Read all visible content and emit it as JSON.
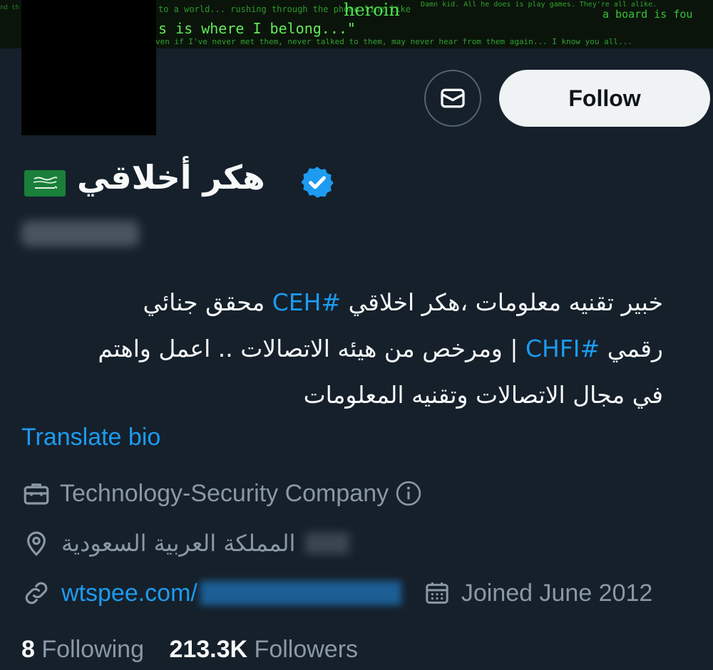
{
  "banner": {
    "line0": "nd th",
    "line1": "to a world... rushing through the phone line like",
    "word_heroin": "heroin",
    "line1b": "Damn kid. All he does is play games. They're all alike.",
    "line_board": "a board is fou",
    "line2": "s is where I belong...\"",
    "line3": "ven if I've never met them, never talked to them, may never hear from them again... I know you all..."
  },
  "profile": {
    "display_name": "هكر أخلاقي",
    "handle": "@CEH_A"
  },
  "actions": {
    "follow_label": "Follow"
  },
  "bio": {
    "line1_text": "خبير تقنيه معلومات ،هكر اخلاقي ",
    "line1_tag": "#CEH",
    "line1_end": " محقق جنائي",
    "line2_start": "رقمي ",
    "line2_tag": "#CHFI",
    "line2_end": " | ومرخص من هيئه الاتصالات .. اعمل واهتم",
    "line3": "في مجال الاتصالات وتقنيه المعلومات"
  },
  "translate_label": "Translate bio",
  "meta": {
    "category": "Technology-Security Company",
    "location": "المملكة العربية السعودية",
    "link": "wtspee.com/",
    "joined": "Joined June 2012"
  },
  "stats": {
    "following_count": "8",
    "following_label": "Following",
    "followers_count": "213.3K",
    "followers_label": "Followers"
  },
  "colors": {
    "background": "#15202b",
    "accent": "#1d9bf0",
    "secondary_text": "#8b98a5"
  }
}
